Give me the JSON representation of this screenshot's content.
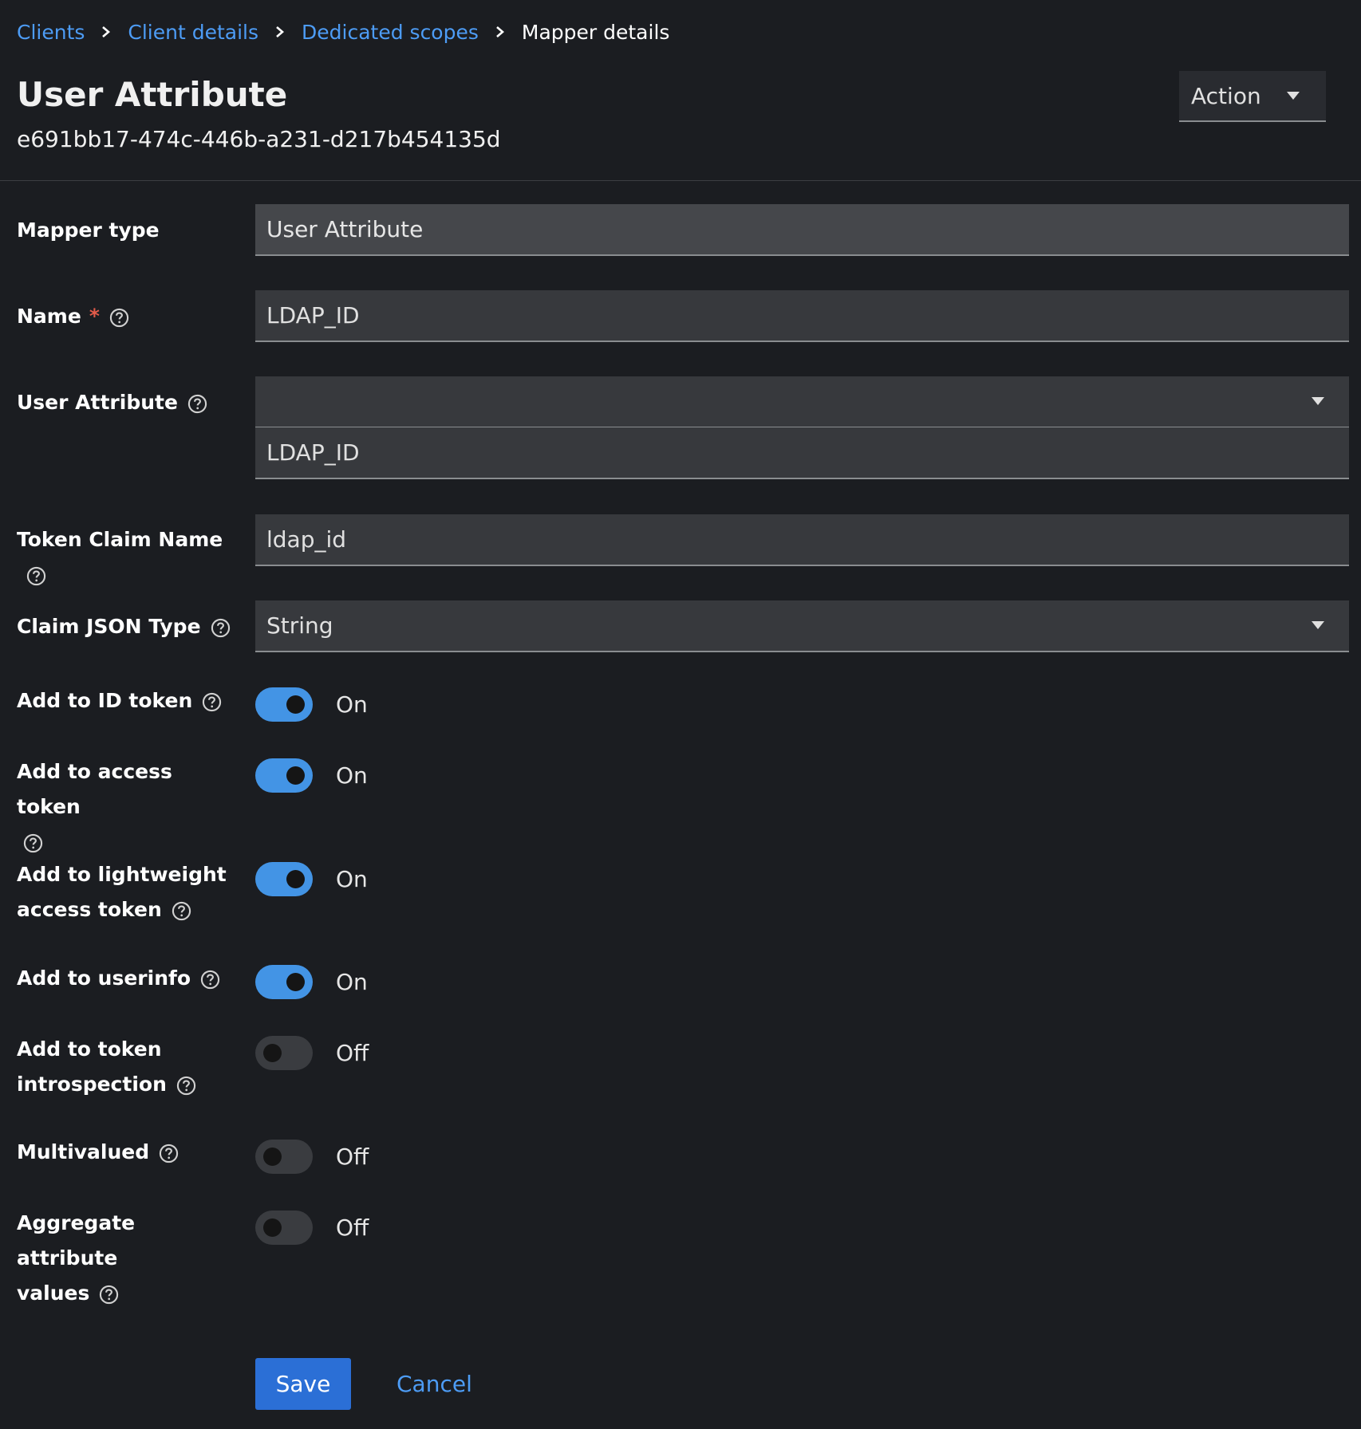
{
  "breadcrumb": {
    "items": [
      "Clients",
      "Client details",
      "Dedicated scopes"
    ],
    "current": "Mapper details"
  },
  "header": {
    "title": "User Attribute",
    "subtitle": "e691bb17-474c-446b-a231-d217b454135d",
    "action_label": "Action"
  },
  "form": {
    "mapper_type": {
      "label": "Mapper type",
      "value": "User Attribute"
    },
    "name": {
      "label": "Name",
      "required_mark": "*",
      "value": "LDAP_ID"
    },
    "user_attribute": {
      "label": "User Attribute",
      "select_value": "",
      "value": "LDAP_ID"
    },
    "token_claim_name": {
      "label": "Token Claim Name",
      "value": "ldap_id"
    },
    "claim_json_type": {
      "label": "Claim JSON Type",
      "value": "String"
    },
    "toggles": [
      {
        "label_line1": "Add to ID token",
        "label_line2": "",
        "state": "On",
        "on": true
      },
      {
        "label_line1": "Add to access token",
        "label_line2": "",
        "state": "On",
        "on": true
      },
      {
        "label_line1": "Add to lightweight",
        "label_line2": "access token",
        "state": "On",
        "on": true
      },
      {
        "label_line1": "Add to userinfo",
        "label_line2": "",
        "state": "On",
        "on": true
      },
      {
        "label_line1": "Add to token",
        "label_line2": "introspection",
        "state": "Off",
        "on": false
      },
      {
        "label_line1": "Multivalued",
        "label_line2": "",
        "state": "Off",
        "on": false
      },
      {
        "label_line1": "Aggregate attribute",
        "label_line2": "values",
        "state": "Off",
        "on": false
      }
    ]
  },
  "footer": {
    "save_label": "Save",
    "cancel_label": "Cancel"
  },
  "colors": {
    "background": "#1b1d21",
    "link": "#4d9cf5",
    "switch_on": "#4394e5",
    "primary_button": "#2b6fd6",
    "required": "#e35b4a"
  }
}
